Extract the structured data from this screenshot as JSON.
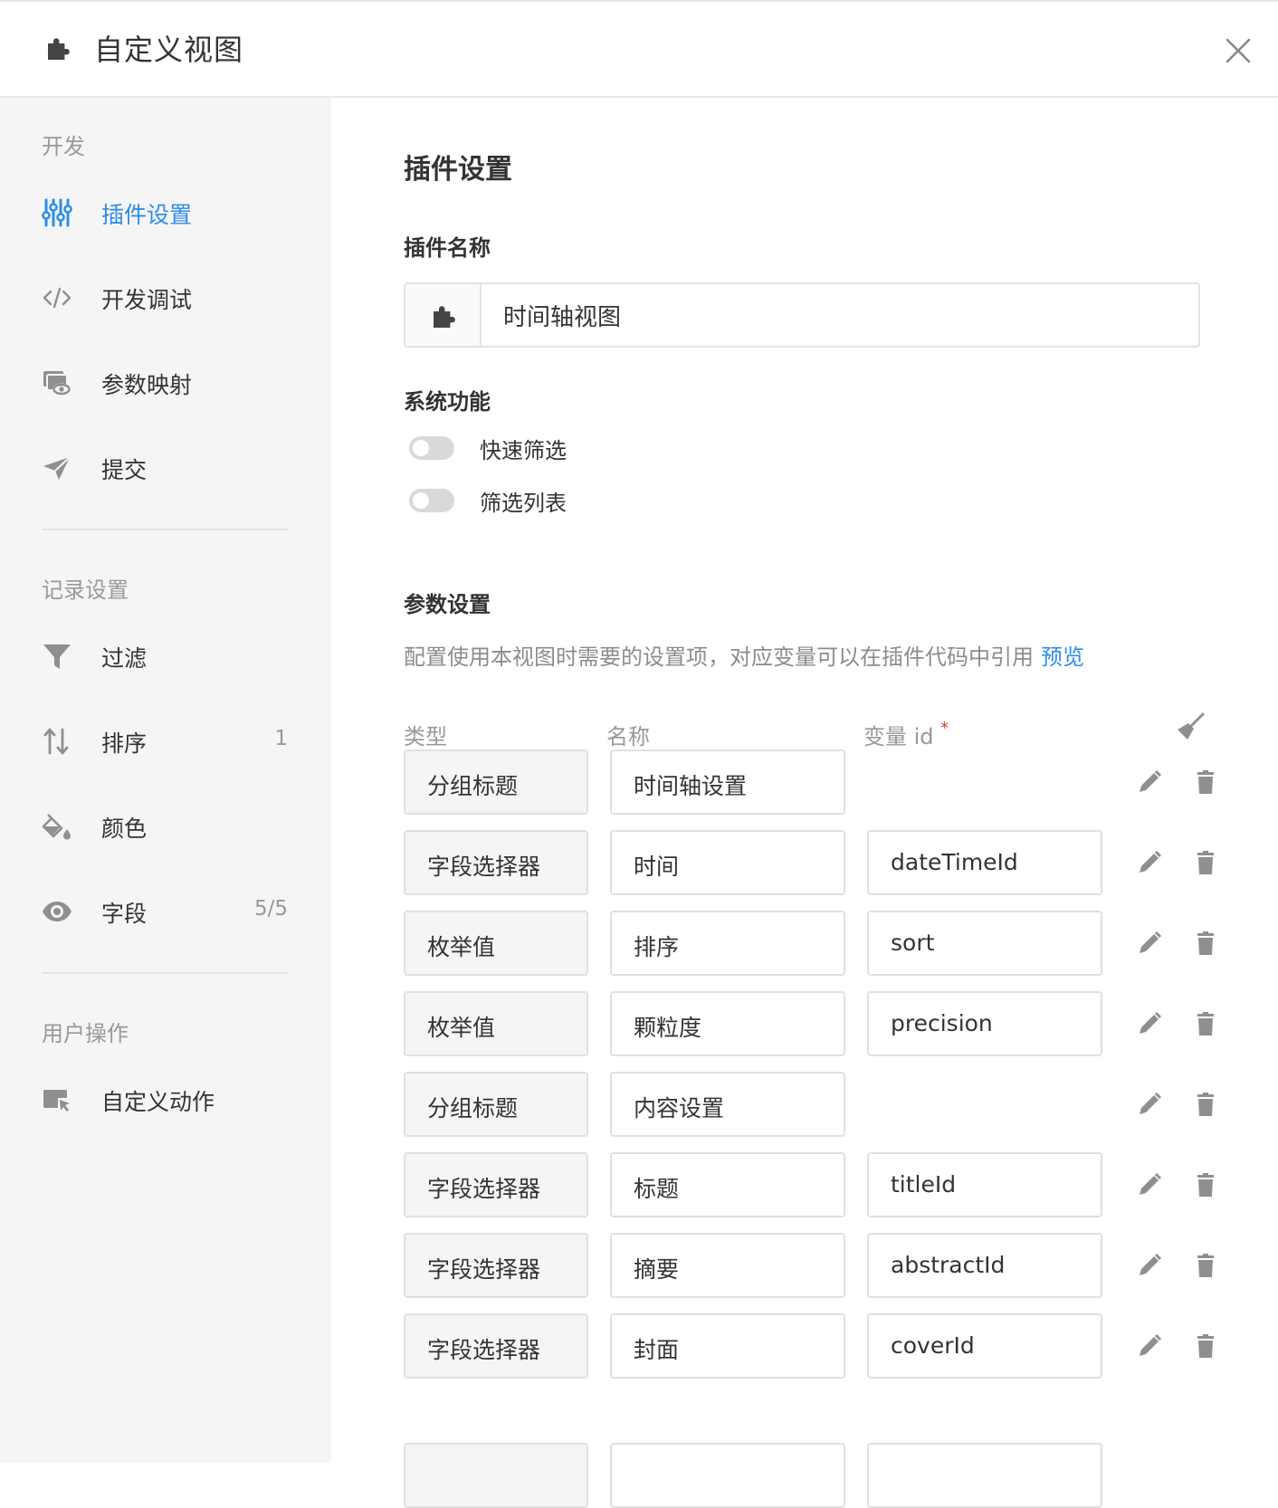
{
  "header": {
    "title": "自定义视图",
    "icon": "puzzle-icon",
    "close_icon": "close-icon"
  },
  "sidebar": {
    "sections": [
      {
        "title": "开发",
        "items": [
          {
            "label": "插件设置",
            "icon": "sliders-icon",
            "active": true
          },
          {
            "label": "开发调试",
            "icon": "code-icon"
          },
          {
            "label": "参数映射",
            "icon": "cards-eye-icon"
          },
          {
            "label": "提交",
            "icon": "send-icon"
          }
        ]
      },
      {
        "title": "记录设置",
        "items": [
          {
            "label": "过滤",
            "icon": "filter-icon"
          },
          {
            "label": "排序",
            "icon": "sort-icon",
            "count": "1"
          },
          {
            "label": "颜色",
            "icon": "paint-bucket-icon"
          },
          {
            "label": "字段",
            "icon": "eye-icon",
            "count": "5/5"
          }
        ]
      },
      {
        "title": "用户操作",
        "items": [
          {
            "label": "自定义动作",
            "icon": "cursor-window-icon"
          }
        ]
      }
    ]
  },
  "main": {
    "title": "插件设置",
    "plugin_name_label": "插件名称",
    "plugin_name_value": "时间轴视图",
    "system_label": "系统功能",
    "toggles": [
      {
        "label": "快速筛选",
        "on": false
      },
      {
        "label": "筛选列表",
        "on": false
      }
    ],
    "params_label": "参数设置",
    "params_desc": "配置使用本视图时需要的设置项，对应变量可以在插件代码中引用",
    "preview_link": "预览",
    "columns": {
      "type": "类型",
      "name": "名称",
      "var_id": "变量 id",
      "required_mark": "*"
    },
    "rows": [
      {
        "type": "分组标题",
        "name": "时间轴设置",
        "var_id": ""
      },
      {
        "type": "字段选择器",
        "name": "时间",
        "var_id": "dateTimeId"
      },
      {
        "type": "枚举值",
        "name": "排序",
        "var_id": "sort"
      },
      {
        "type": "枚举值",
        "name": "颗粒度",
        "var_id": "precision"
      },
      {
        "type": "分组标题",
        "name": "内容设置",
        "var_id": ""
      },
      {
        "type": "字段选择器",
        "name": "标题",
        "var_id": "titleId"
      },
      {
        "type": "字段选择器",
        "name": "摘要",
        "var_id": "abstractId"
      },
      {
        "type": "字段选择器",
        "name": "封面",
        "var_id": "coverId"
      }
    ]
  },
  "colors": {
    "accent": "#2e8de6",
    "sidebar_bg": "#f5f5f5",
    "icon_gray": "#8f8f8f",
    "required": "#e53935"
  }
}
